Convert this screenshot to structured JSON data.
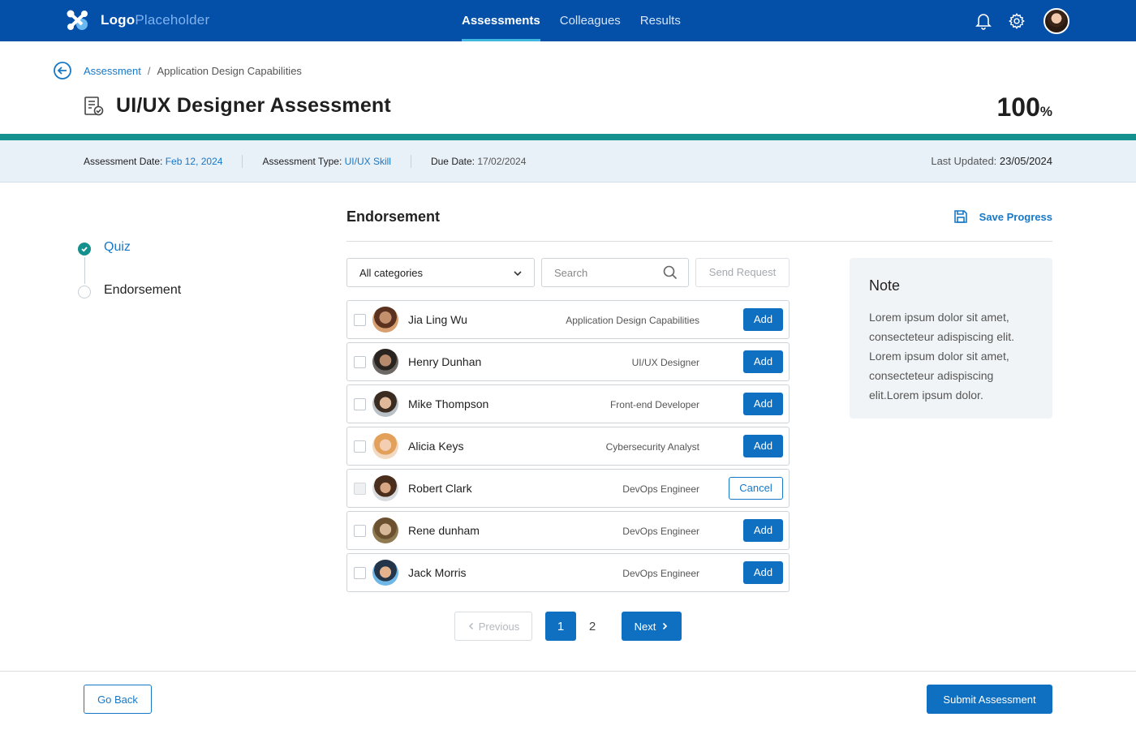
{
  "app": {
    "logo_bold": "Logo",
    "logo_light": "Placeholder",
    "nav": [
      {
        "label": "Assessments",
        "active": true
      },
      {
        "label": "Colleagues",
        "active": false
      },
      {
        "label": "Results",
        "active": false
      }
    ],
    "icons": [
      "bell-icon",
      "gear-icon"
    ],
    "brand_color": "#0450a8",
    "accent_color": "#14908e"
  },
  "breadcrumb": {
    "root": "Assessment",
    "separator": "/",
    "current": "Application Design Capabilities"
  },
  "header": {
    "title": "UI/UX Designer Assessment",
    "percent_value": "100",
    "percent_sign": "%",
    "progress": 1.0
  },
  "info": {
    "date_label": "Assessment Date:",
    "date_value": "Feb 12, 2024",
    "type_label": "Assessment Type:",
    "type_value": "UI/UX Skill",
    "due_label": "Due Date:",
    "due_value": "17/02/2024",
    "updated_label": "Last Updated:",
    "updated_value": "23/05/2024"
  },
  "stepper": [
    {
      "label": "Quiz",
      "status": "done"
    },
    {
      "label": "Endorsement",
      "status": "todo"
    }
  ],
  "section": {
    "title": "Endorsement",
    "save_label": "Save Progress"
  },
  "filters": {
    "category_value": "All categories",
    "search_placeholder": "Search",
    "send_label": "Send Request"
  },
  "colleagues": [
    {
      "name": "Jia Ling Wu",
      "role": "Application Design Capabilities",
      "action": "Add"
    },
    {
      "name": "Henry Dunhan",
      "role": "UI/UX Designer",
      "action": "Add"
    },
    {
      "name": "Mike Thompson",
      "role": "Front-end Developer",
      "action": "Add"
    },
    {
      "name": "Alicia Keys",
      "role": "Cybersecurity Analyst",
      "action": "Add"
    },
    {
      "name": "Robert Clark",
      "role": "DevOps Engineer",
      "action": "Cancel"
    },
    {
      "name": "Rene dunham",
      "role": "DevOps Engineer",
      "action": "Add"
    },
    {
      "name": "Jack Morris",
      "role": "DevOps Engineer",
      "action": "Add"
    }
  ],
  "note": {
    "title": "Note",
    "body": "Lorem ipsum dolor sit amet, consecteteur adispiscing elit. Lorem ipsum dolor sit amet, consecteteur adispiscing elit.Lorem ipsum dolor."
  },
  "pagination": {
    "prev_label": "Previous",
    "pages": [
      "1",
      "2"
    ],
    "current": "1",
    "next_label": "Next"
  },
  "footer": {
    "back_label": "Go Back",
    "submit_label": "Submit Assessment"
  }
}
